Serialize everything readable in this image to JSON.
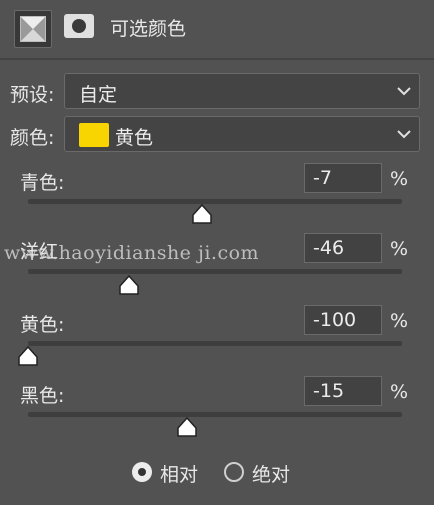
{
  "header": {
    "title": "可选颜色",
    "adjustment_icon": "selective-color-icon",
    "mask_icon": "mask-icon"
  },
  "preset": {
    "label": "预设:",
    "value": "自定"
  },
  "colors": {
    "label": "颜色:",
    "value": "黄色",
    "swatch_color": "#f8d500"
  },
  "sliders": [
    {
      "label": "青色:",
      "value": "-7",
      "unit": "%",
      "level": -7
    },
    {
      "label": "洋红",
      "value": "-46",
      "unit": "%",
      "level": -46
    },
    {
      "label": "黄色:",
      "value": "-100",
      "unit": "%",
      "level": -100
    },
    {
      "label": "黑色:",
      "value": "-15",
      "unit": "%",
      "level": -15
    }
  ],
  "method": {
    "options": [
      {
        "label": "相对",
        "selected": true
      },
      {
        "label": "绝对",
        "selected": false
      }
    ]
  },
  "watermark": "www.haoyidianshe ji.com"
}
